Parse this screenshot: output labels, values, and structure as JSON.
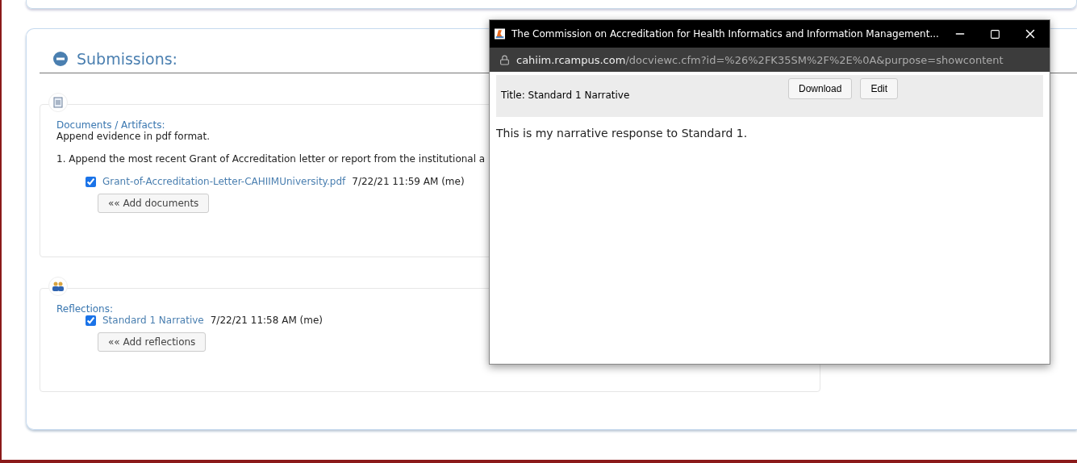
{
  "section": {
    "title": "Submissions:",
    "expanded": true
  },
  "groups": [
    {
      "kind": "documents",
      "heading": "Documents / Artifacts:",
      "note": "Append evidence in pdf format.",
      "instruction": "1. Append the most recent Grant of Accreditation letter or report from the institutional a",
      "items": [
        {
          "name": "Grant-of-Accreditation-Letter-CAHIIMUniversity.pdf",
          "meta": "7/22/21 11:59 AM (me)",
          "checked": true
        }
      ],
      "button": "«« Add documents"
    },
    {
      "kind": "reflections",
      "heading": "Reflections:",
      "items": [
        {
          "name": "Standard 1 Narrative",
          "meta": "7/22/21 11:58 AM (me)",
          "checked": true
        }
      ],
      "button": "«« Add reflections"
    }
  ],
  "popup": {
    "title": "The Commission on Accreditation for Health Informatics and Information Management...",
    "url_host": "cahiim.rcampus.com",
    "url_path": "/docviewc.cfm?id=%26%2FK35SM%2F%2E%0A&purpose=showcontent",
    "doc_title": "Title: Standard 1 Narrative",
    "buttons": [
      "Download",
      "Edit"
    ],
    "body": "This is my narrative response to Standard 1."
  }
}
